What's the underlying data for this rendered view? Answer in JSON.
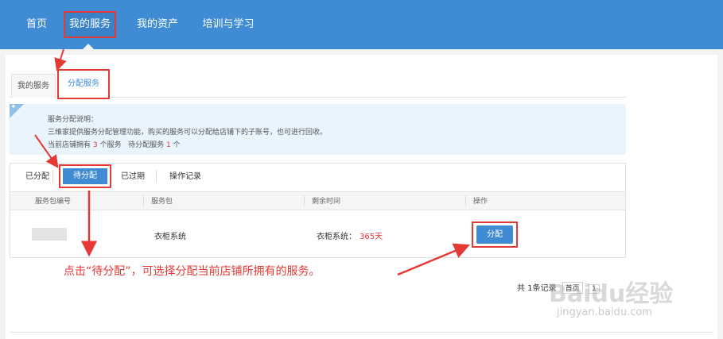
{
  "nav": {
    "items": [
      "首页",
      "我的服务",
      "我的资产",
      "培训与学习"
    ]
  },
  "tabs": [
    "我的服务",
    "分配服务"
  ],
  "info": {
    "title": "服务分配说明：",
    "desc": "三维家提供服务分配管理功能，购买的服务可以分配给店铺下的子账号，也可进行回收。",
    "count_prefix": "当前店铺拥有",
    "owned_count": "3",
    "count_mid": "个服务",
    "pending_label": "待分配服务",
    "pending_count": "1",
    "count_suffix": "个"
  },
  "subtabs": [
    "已分配",
    "待分配",
    "已过期",
    "操作记录"
  ],
  "table": {
    "headers": [
      "服务包编号",
      "服务包",
      "剩余时间",
      "操作"
    ],
    "rows": [
      {
        "package": "衣柜系统",
        "remain_label": "衣柜系统：",
        "remain_value": "365天",
        "action": "分配"
      }
    ]
  },
  "annotation": "点击“待分配”，可选择分配当前店铺所拥有的服务。",
  "pager": {
    "total": "共 1条记录",
    "prev": "首页",
    "page": "1"
  },
  "watermark": {
    "logo": "Baidu经验",
    "url": "jingyan.baidu.com"
  },
  "colors": {
    "nav_bg": "#3f8cd4",
    "highlight": "#e53935",
    "info_bg": "#eaf4fd"
  }
}
